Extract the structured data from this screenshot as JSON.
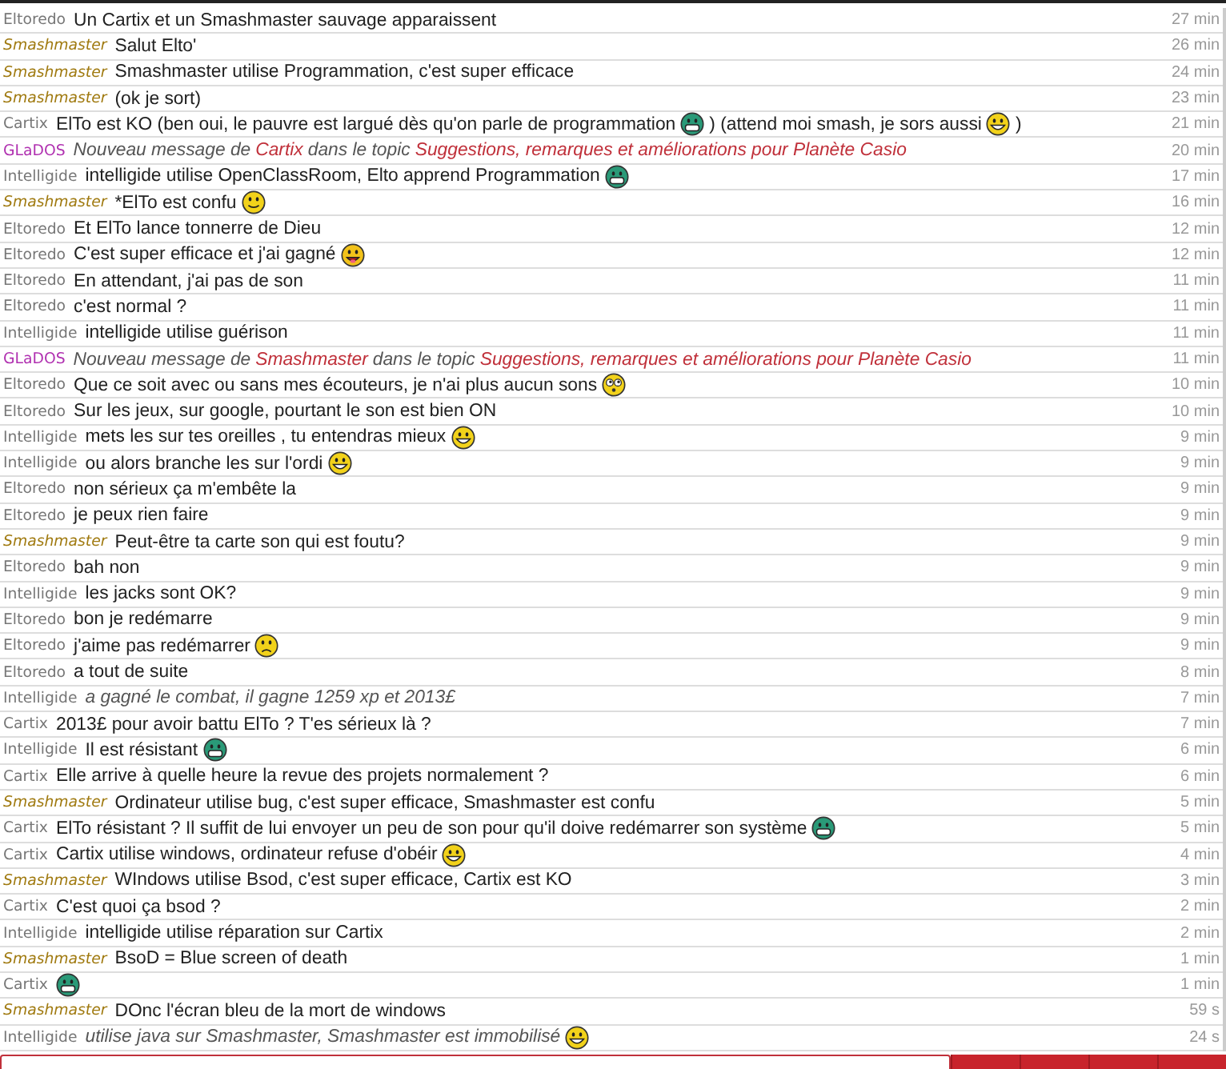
{
  "messages": [
    {
      "author": {
        "name": "Eltoredo",
        "kind": "member"
      },
      "time": "27 min",
      "parts": [
        {
          "kind": "text",
          "text": "Un Cartix et un Smashmaster sauvage apparaissent"
        }
      ]
    },
    {
      "author": {
        "name": "Smashmaster",
        "kind": "premium"
      },
      "time": "26 min",
      "parts": [
        {
          "kind": "text",
          "text": "Salut Elto'"
        }
      ]
    },
    {
      "author": {
        "name": "Smashmaster",
        "kind": "premium"
      },
      "time": "24 min",
      "parts": [
        {
          "kind": "text",
          "text": "Smashmaster utilise Programmation, c'est super efficace"
        }
      ]
    },
    {
      "author": {
        "name": "Smashmaster",
        "kind": "premium"
      },
      "time": "23 min",
      "parts": [
        {
          "kind": "text",
          "text": "(ok je sort)"
        }
      ]
    },
    {
      "author": {
        "name": "Cartix",
        "kind": "member"
      },
      "time": "21 min",
      "parts": [
        {
          "kind": "text",
          "text": "ElTo est KO (ben oui, le pauvre est largué dès qu'on parle de programmation"
        },
        {
          "kind": "grin"
        },
        {
          "kind": "text",
          "text": ") (attend moi smash, je sors aussi"
        },
        {
          "kind": "laugh"
        },
        {
          "kind": "text",
          "text": ")"
        }
      ]
    },
    {
      "author": {
        "name": "GLaDOS",
        "kind": "bot"
      },
      "time": "20 min",
      "parts": [
        {
          "kind": "emote",
          "text": "Nouveau message de"
        },
        {
          "kind": "link",
          "text": "Cartix"
        },
        {
          "kind": "emote",
          "text": "dans le topic"
        },
        {
          "kind": "link",
          "text": "Suggestions, remarques et améliorations pour Planète Casio"
        }
      ]
    },
    {
      "author": {
        "name": "Intelligide",
        "kind": "member"
      },
      "time": "17 min",
      "parts": [
        {
          "kind": "text",
          "text": "intelligide utilise OpenClassRoom, Elto apprend Programmation"
        },
        {
          "kind": "grin"
        }
      ]
    },
    {
      "author": {
        "name": "Smashmaster",
        "kind": "premium"
      },
      "time": "16 min",
      "parts": [
        {
          "kind": "text",
          "text": "*ElTo est confu"
        },
        {
          "kind": "smile"
        }
      ]
    },
    {
      "author": {
        "name": "Eltoredo",
        "kind": "member"
      },
      "time": "12 min",
      "parts": [
        {
          "kind": "text",
          "text": "Et ElTo lance tonnerre de Dieu"
        }
      ]
    },
    {
      "author": {
        "name": "Eltoredo",
        "kind": "member"
      },
      "time": "12 min",
      "parts": [
        {
          "kind": "text",
          "text": "C'est super efficace et j'ai gagné"
        },
        {
          "kind": "tongue"
        }
      ]
    },
    {
      "author": {
        "name": "Eltoredo",
        "kind": "member"
      },
      "time": "11 min",
      "parts": [
        {
          "kind": "text",
          "text": "En attendant, j'ai pas de son"
        }
      ]
    },
    {
      "author": {
        "name": "Eltoredo",
        "kind": "member"
      },
      "time": "11 min",
      "parts": [
        {
          "kind": "text",
          "text": "c'est normal ?"
        }
      ]
    },
    {
      "author": {
        "name": "Intelligide",
        "kind": "member"
      },
      "time": "11 min",
      "parts": [
        {
          "kind": "text",
          "text": "intelligide utilise guérison"
        }
      ]
    },
    {
      "author": {
        "name": "GLaDOS",
        "kind": "bot"
      },
      "time": "11 min",
      "parts": [
        {
          "kind": "emote",
          "text": "Nouveau message de"
        },
        {
          "kind": "link",
          "text": "Smashmaster"
        },
        {
          "kind": "emote",
          "text": "dans le topic"
        },
        {
          "kind": "link",
          "text": "Suggestions, remarques et améliorations pour Planète Casio"
        }
      ]
    },
    {
      "author": {
        "name": "Eltoredo",
        "kind": "member"
      },
      "time": "10 min",
      "parts": [
        {
          "kind": "text",
          "text": "Que ce soit avec ou sans mes écouteurs, je n'ai plus aucun sons"
        },
        {
          "kind": "eyes"
        }
      ]
    },
    {
      "author": {
        "name": "Eltoredo",
        "kind": "member"
      },
      "time": "10 min",
      "parts": [
        {
          "kind": "text",
          "text": "Sur les jeux, sur google, pourtant le son est bien ON"
        }
      ]
    },
    {
      "author": {
        "name": "Intelligide",
        "kind": "member"
      },
      "time": "9 min",
      "parts": [
        {
          "kind": "text",
          "text": "mets les sur tes oreilles , tu entendras mieux"
        },
        {
          "kind": "laugh"
        }
      ]
    },
    {
      "author": {
        "name": "Intelligide",
        "kind": "member"
      },
      "time": "9 min",
      "parts": [
        {
          "kind": "text",
          "text": "ou alors branche les sur l'ordi"
        },
        {
          "kind": "laugh"
        }
      ]
    },
    {
      "author": {
        "name": "Eltoredo",
        "kind": "member"
      },
      "time": "9 min",
      "parts": [
        {
          "kind": "text",
          "text": "non sérieux ça m'embête la"
        }
      ]
    },
    {
      "author": {
        "name": "Eltoredo",
        "kind": "member"
      },
      "time": "9 min",
      "parts": [
        {
          "kind": "text",
          "text": "je peux rien faire"
        }
      ]
    },
    {
      "author": {
        "name": "Smashmaster",
        "kind": "premium"
      },
      "time": "9 min",
      "parts": [
        {
          "kind": "text",
          "text": "Peut-être ta carte son qui est foutu?"
        }
      ]
    },
    {
      "author": {
        "name": "Eltoredo",
        "kind": "member"
      },
      "time": "9 min",
      "parts": [
        {
          "kind": "text",
          "text": "bah non"
        }
      ]
    },
    {
      "author": {
        "name": "Intelligide",
        "kind": "member"
      },
      "time": "9 min",
      "parts": [
        {
          "kind": "text",
          "text": "les jacks sont OK?"
        }
      ]
    },
    {
      "author": {
        "name": "Eltoredo",
        "kind": "member"
      },
      "time": "9 min",
      "parts": [
        {
          "kind": "text",
          "text": "bon je redémarre"
        }
      ]
    },
    {
      "author": {
        "name": "Eltoredo",
        "kind": "member"
      },
      "time": "9 min",
      "parts": [
        {
          "kind": "text",
          "text": "j'aime pas redémarrer"
        },
        {
          "kind": "sad"
        }
      ]
    },
    {
      "author": {
        "name": "Eltoredo",
        "kind": "member"
      },
      "time": "8 min",
      "parts": [
        {
          "kind": "text",
          "text": "a tout de suite"
        }
      ]
    },
    {
      "author": {
        "name": "Intelligide",
        "kind": "member"
      },
      "time": "7 min",
      "parts": [
        {
          "kind": "emote",
          "text": "a gagné le combat, il gagne 1259 xp et 2013£"
        }
      ]
    },
    {
      "author": {
        "name": "Cartix",
        "kind": "member"
      },
      "time": "7 min",
      "parts": [
        {
          "kind": "text",
          "text": "2013£ pour avoir battu ElTo ? T'es sérieux là ?"
        }
      ]
    },
    {
      "author": {
        "name": "Intelligide",
        "kind": "member"
      },
      "time": "6 min",
      "parts": [
        {
          "kind": "text",
          "text": "Il est résistant"
        },
        {
          "kind": "grin"
        }
      ]
    },
    {
      "author": {
        "name": "Cartix",
        "kind": "member"
      },
      "time": "6 min",
      "parts": [
        {
          "kind": "text",
          "text": "Elle arrive à quelle heure la revue des projets normalement ?"
        }
      ]
    },
    {
      "author": {
        "name": "Smashmaster",
        "kind": "premium"
      },
      "time": "5 min",
      "parts": [
        {
          "kind": "text",
          "text": "Ordinateur utilise bug, c'est super efficace, Smashmaster est confu"
        }
      ]
    },
    {
      "author": {
        "name": "Cartix",
        "kind": "member"
      },
      "time": "5 min",
      "parts": [
        {
          "kind": "text",
          "text": "ElTo résistant ? Il suffit de lui envoyer un peu de son pour qu'il doive redémarrer son système"
        },
        {
          "kind": "grin"
        }
      ]
    },
    {
      "author": {
        "name": "Cartix",
        "kind": "member"
      },
      "time": "4 min",
      "parts": [
        {
          "kind": "text",
          "text": "Cartix utilise windows, ordinateur refuse d'obéir"
        },
        {
          "kind": "laugh"
        }
      ]
    },
    {
      "author": {
        "name": "Smashmaster",
        "kind": "premium"
      },
      "time": "3 min",
      "parts": [
        {
          "kind": "text",
          "text": "WIndows utilise Bsod, c'est super efficace, Cartix est KO"
        }
      ]
    },
    {
      "author": {
        "name": "Cartix",
        "kind": "member"
      },
      "time": "2 min",
      "parts": [
        {
          "kind": "text",
          "text": "C'est quoi ça bsod ?"
        }
      ]
    },
    {
      "author": {
        "name": "Intelligide",
        "kind": "member"
      },
      "time": "2 min",
      "parts": [
        {
          "kind": "text",
          "text": "intelligide utilise réparation sur Cartix"
        }
      ]
    },
    {
      "author": {
        "name": "Smashmaster",
        "kind": "premium"
      },
      "time": "1 min",
      "parts": [
        {
          "kind": "text",
          "text": "BsoD = Blue screen of death"
        }
      ]
    },
    {
      "author": {
        "name": "Cartix",
        "kind": "member"
      },
      "time": "1 min",
      "parts": [
        {
          "kind": "grin"
        }
      ]
    },
    {
      "author": {
        "name": "Smashmaster",
        "kind": "premium"
      },
      "time": "59 s",
      "parts": [
        {
          "kind": "text",
          "text": "DOnc l'écran bleu de la mort de windows"
        }
      ]
    },
    {
      "author": {
        "name": "Intelligide",
        "kind": "member"
      },
      "time": "24 s",
      "parts": [
        {
          "kind": "emote",
          "text": "utilise java sur Smashmaster, Smashmaster est immobilisé"
        },
        {
          "kind": "laugh"
        }
      ]
    }
  ]
}
